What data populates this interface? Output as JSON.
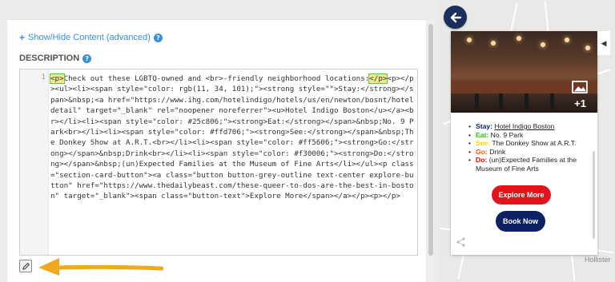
{
  "editor": {
    "toggle_label": "Show/Hide Content (advanced)",
    "description_label": "DESCRIPTION",
    "line_number": "1",
    "code_open_tag": "<p>",
    "code_after_open": "Check out these LGBTQ-owned and <br>-friendly neighborhood locations:",
    "code_close_tag": "</p>",
    "code_rest": "<p></p><ul><li><span style=\"color: rgb(11, 34, 101);\"><strong style=\"\">Stay:</strong></span>&nbsp;<a href=\"https://www.ihg.com/hotelindigo/hotels/us/en/newton/bosnt/hoteldetail\" target=\"_blank\" rel=\"noopener noreferrer\"><u>Hotel Indigo Boston</u></a><br></li><li><span style=\"color: #25c806;\"><strong>Eat:</strong></span>&nbsp;No. 9 Park<br></li><li><span style=\"color: #ffd706;\"><strong>See:</strong></span>&nbsp;The Donkey Show at A.R.T.<br></li><li><span style=\"color: #ff5606;\"><strong>Go:</strong></span>&nbsp;Drink<br></li><li><span style=\"color: #f30006;\"><strong>Do:</strong></span>&nbsp;(un)Expected Families at the Museum of Fine Arts</li></ul><p class=\"section-card-button\"><a class=\"button button-grey-outline text-center explore-button\" href=\"https://www.thedailybeast.com/these-queer-to-dos-are-the-best-in-boston\" target=\"_blank\"><span class=\"button-text\">Explore More</span></a></p><p></p>"
  },
  "map": {
    "label_hollister": "Hollister"
  },
  "card": {
    "photo_count": "+1",
    "items": [
      {
        "key": "Stay:",
        "value": "Hotel Indigo Boston"
      },
      {
        "key": "Eat:",
        "value": "No. 9 Park"
      },
      {
        "key": "See:",
        "value": "The Donkey Show at A.R.T."
      },
      {
        "key": "Go:",
        "value": "Drink"
      },
      {
        "key": "Do:",
        "value": "(un)Expected Families at the Museum of Fine Arts"
      }
    ],
    "explore_button": "Explore More",
    "book_button": "Book Now"
  },
  "colors": {
    "stay": "#0b2265",
    "eat": "#25c806",
    "see": "#ffd706",
    "go": "#ff5606",
    "do": "#f30006",
    "explore_button": "#e4131b",
    "book_button": "#0e2164",
    "link_blue": "#3a8fd8",
    "annotation_arrow": "#f0a81d"
  },
  "icons": {
    "help": "question-circle-icon",
    "back": "arrow-left-icon",
    "photos": "image-gallery-icon",
    "collapse": "chevron-left-icon",
    "share": "share-icon",
    "edit": "pencil-icon"
  }
}
